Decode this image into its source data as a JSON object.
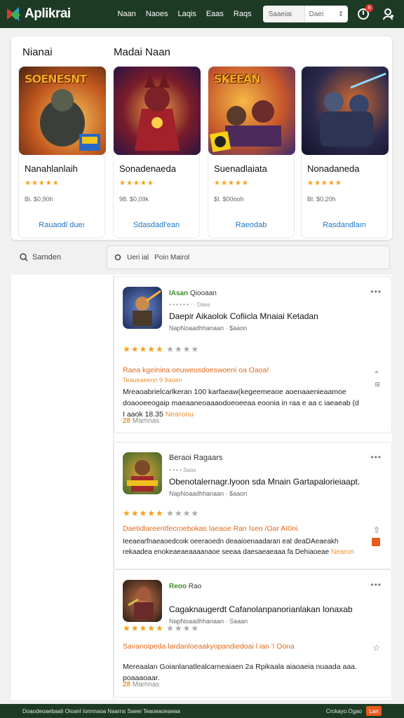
{
  "app": {
    "logo_text": "Aplikrai"
  },
  "nav": {
    "items": [
      "Naan",
      "Naoes",
      "Laqis",
      "Eaas",
      "Raqs"
    ]
  },
  "search_top": {
    "left": "Saaeiai",
    "right": "Daei",
    "icon": "chevron-icon"
  },
  "notifications": {
    "badge": "8"
  },
  "featured": {
    "heading_left": "Nianai",
    "heading_right": "Madai Naan",
    "cards": [
      {
        "art_title": "SOENESNT",
        "name": "Nanahlanlaih",
        "stars": "★★★★★",
        "price": "Bi. $0,90h",
        "link": "Rauaodl dueı",
        "colors": [
          "#f0a93a",
          "#7b3a1a"
        ]
      },
      {
        "art_title": "",
        "name": "Sonadenaeda",
        "stars": "★★★★★",
        "price": "98. $0,09k",
        "link": "Sdasdadl'ean",
        "colors": [
          "#5a1f3a",
          "#d8332a"
        ]
      },
      {
        "art_title": "SKEEAN",
        "name": "Suenadlaiata",
        "stars": "★★★★★",
        "price": "$I. $00ooh",
        "link": "Raeodab",
        "colors": [
          "#f3a436",
          "#4a2f73"
        ]
      },
      {
        "art_title": "",
        "name": "Nonadaneda",
        "stars": "★★★★★",
        "price": "Bl. $0,20h",
        "link": "Rasdandlaın",
        "colors": [
          "#1f2547",
          "#c2552a"
        ]
      }
    ]
  },
  "filter": {
    "search_label": "Samden",
    "box_a": "Ueri ial",
    "box_b": "Poin Mairol"
  },
  "reviews": [
    {
      "tag": "IAsan",
      "tag_rest": "Qiooaan",
      "meta": "• • • • • • · · Daas",
      "title": "Daepir Aikaolok Cofiicla Mnaiai Ketadan",
      "sub": "NapNoaadhhanaan · $aaon",
      "stars_on": "★★★★★",
      "stars_off": "★★★★",
      "headline": "Raea kgeiniea oeuweusdoeswoeni oa Oaoa!",
      "headline2": "Teaueaeenn 9 9aoen",
      "body": "Mreaoabrielcarlkeran 100 karfaeaw(kegeemeaoe aoenaaenieaamoe doaooeeogaip maeaaneoaaaodoeoeeaa eoonia in raa e aa c iaeaeab (d I aaok 18.35 ",
      "body_em": "Nearonu",
      "foot_num": "28",
      "foot_text": "Mamnas"
    },
    {
      "tag": "",
      "tag_rest": "Beraoi Ragaars",
      "meta": "• • • • Saas",
      "title": "Obenotalernagr.lyoon sda Mnain Gartapalorieiaapt.",
      "sub": "NapNoaadhhanaan · $aaon",
      "stars_on": "★★★★★",
      "stars_off": "★★★★",
      "headline": "Daetidlareentfecroebokas Iaeaoe Ran Iseo /Oar AI0ni.",
      "headline2": "",
      "body": "Ieeaearfnaeaoedcoik oeeraoedn deaaioenaadaran eat deaDAeaeakh rekaadea enokeaeaeaaaanaoe seeaa daesaeaeaaa fa Dehiaoeae ",
      "body_em": "Nearon",
      "foot_num": "",
      "foot_text": ""
    },
    {
      "tag": "Reoo",
      "tag_rest": "Rao",
      "meta": "",
      "title": "Cagaknaugerdt Cafanolanpanorianlakan Ionaxab",
      "sub": "NapNoaadhhanaan · Saaan",
      "stars_on": "★★★★★",
      "stars_off": "★★★★",
      "headline": "Savanoipeda lardanloeaakyopandiedoai l ian 'i Oona",
      "headline2": "",
      "body": "Mereaalan Goianlanatlealcarneaiaen 2a Rpikaala aiaoaeia nuaada aaa. poaaaoaar.",
      "body_em": "",
      "foot_num": "28",
      "foot_text": "Mamnas"
    }
  ],
  "bottombar": {
    "left": "Doaodeoaebaali Oioanl Ionnnaoa Naarns Saeei Teaoeaoeaeaa",
    "right": "Crckayo.Ogao",
    "badge": "Lan"
  }
}
